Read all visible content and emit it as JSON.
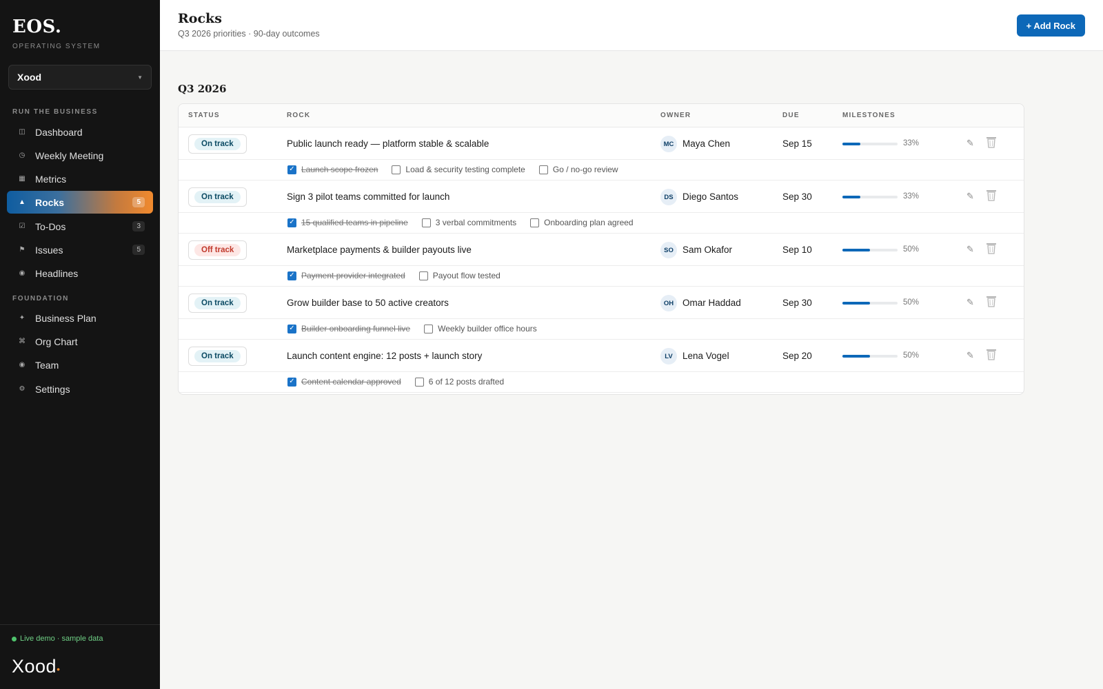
{
  "sidebar": {
    "brand": "EOS.",
    "brand_sub": "OPERATING SYSTEM",
    "org": "Xood",
    "sections": {
      "run": "RUN THE BUSINESS",
      "foundation": "FOUNDATION"
    },
    "items": [
      {
        "label": "Dashboard",
        "icon": "dashboard-icon",
        "glyph": "◫"
      },
      {
        "label": "Weekly Meeting",
        "icon": "clock-icon",
        "glyph": "◷"
      },
      {
        "label": "Metrics",
        "icon": "grid-icon",
        "glyph": "▦"
      },
      {
        "label": "Rocks",
        "icon": "mountain-icon",
        "glyph": "▲",
        "count": "5"
      },
      {
        "label": "To-Dos",
        "icon": "checkbox-icon",
        "glyph": "☑",
        "count": "3"
      },
      {
        "label": "Issues",
        "icon": "flag-icon",
        "glyph": "⚑",
        "count": "5"
      },
      {
        "label": "Headlines",
        "icon": "megaphone-icon",
        "glyph": "◉"
      },
      {
        "label": "Business Plan",
        "icon": "star-icon",
        "glyph": "✦"
      },
      {
        "label": "Org Chart",
        "icon": "org-chart-icon",
        "glyph": "⌘"
      },
      {
        "label": "Team",
        "icon": "team-icon",
        "glyph": "◉"
      },
      {
        "label": "Settings",
        "icon": "gear-icon",
        "glyph": "⚙"
      }
    ],
    "live": "Live demo · sample data",
    "logo": "Xood"
  },
  "header": {
    "title": "Rocks",
    "subtitle": "Q3 2026 priorities · 90-day outcomes",
    "add_label": "+ Add Rock"
  },
  "quarter": "Q3 2026",
  "columns": {
    "status": "STATUS",
    "rock": "ROCK",
    "owner": "OWNER",
    "due": "DUE",
    "milestones": "MILESTONES"
  },
  "rocks": [
    {
      "status": "On track",
      "status_kind": "on",
      "title": "Public launch ready — platform stable & scalable",
      "initials": "MC",
      "owner": "Maya Chen",
      "due": "Sep 15",
      "progress": 33,
      "progress_label": "33%",
      "milestones": [
        {
          "text": "Launch scope frozen",
          "done": true
        },
        {
          "text": "Load & security testing complete",
          "done": false
        },
        {
          "text": "Go / no-go review",
          "done": false
        }
      ]
    },
    {
      "status": "On track",
      "status_kind": "on",
      "title": "Sign 3 pilot teams committed for launch",
      "initials": "DS",
      "owner": "Diego Santos",
      "due": "Sep 30",
      "progress": 33,
      "progress_label": "33%",
      "milestones": [
        {
          "text": "15 qualified teams in pipeline",
          "done": true
        },
        {
          "text": "3 verbal commitments",
          "done": false
        },
        {
          "text": "Onboarding plan agreed",
          "done": false
        }
      ]
    },
    {
      "status": "Off track",
      "status_kind": "off",
      "title": "Marketplace payments & builder payouts live",
      "initials": "SO",
      "owner": "Sam Okafor",
      "due": "Sep 10",
      "progress": 50,
      "progress_label": "50%",
      "milestones": [
        {
          "text": "Payment provider integrated",
          "done": true
        },
        {
          "text": "Payout flow tested",
          "done": false
        }
      ]
    },
    {
      "status": "On track",
      "status_kind": "on",
      "title": "Grow builder base to 50 active creators",
      "initials": "OH",
      "owner": "Omar Haddad",
      "due": "Sep 30",
      "progress": 50,
      "progress_label": "50%",
      "milestones": [
        {
          "text": "Builder onboarding funnel live",
          "done": true
        },
        {
          "text": "Weekly builder office hours",
          "done": false
        }
      ]
    },
    {
      "status": "On track",
      "status_kind": "on",
      "title": "Launch content engine: 12 posts + launch story",
      "initials": "LV",
      "owner": "Lena Vogel",
      "due": "Sep 20",
      "progress": 50,
      "progress_label": "50%",
      "milestones": [
        {
          "text": "Content calendar approved",
          "done": true
        },
        {
          "text": "6 of 12 posts drafted",
          "done": false
        }
      ]
    }
  ],
  "colors": {
    "accent": "#0d68b8",
    "sidebar_bg": "#141414",
    "on_track": "#0b4a63",
    "off_track": "#c0392b"
  }
}
